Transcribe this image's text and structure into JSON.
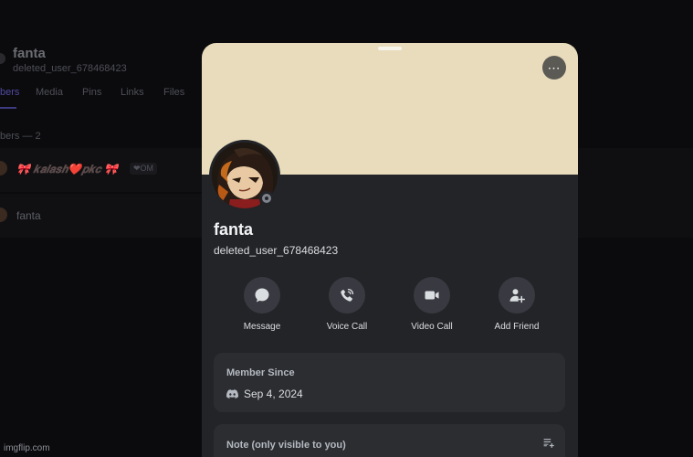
{
  "background": {
    "name": "fanta",
    "username": "deleted_user_678468423",
    "tabs": [
      "bers",
      "Media",
      "Pins",
      "Links",
      "Files"
    ],
    "members_count": "bers — 2",
    "members": [
      {
        "name": "🎀 𝒌𝒂𝒍𝒂𝒔𝒉❤️𝒑𝒌𝒄 🎀",
        "badge": "❤OM"
      },
      {
        "name": "fanta"
      }
    ]
  },
  "profile": {
    "display_name": "fanta",
    "username": "deleted_user_678468423",
    "banner_color": "#e8dcbc",
    "status": "offline",
    "more_icon": "⋯"
  },
  "actions": [
    {
      "label": "Message",
      "icon": "chat-bubble-icon"
    },
    {
      "label": "Voice Call",
      "icon": "phone-icon"
    },
    {
      "label": "Video Call",
      "icon": "video-camera-icon"
    },
    {
      "label": "Add Friend",
      "icon": "add-friend-icon"
    }
  ],
  "member_since": {
    "title": "Member Since",
    "date": "Sep 4, 2024"
  },
  "note": {
    "title": "Note (only visible to you)"
  },
  "watermark": "imgflip.com"
}
